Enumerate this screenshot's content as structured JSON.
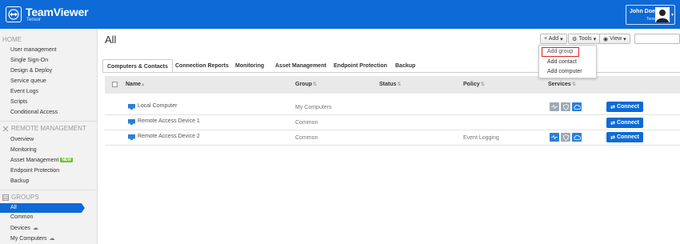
{
  "header": {
    "brand": "TeamViewer",
    "brand_sub": "Tensor",
    "user_name": "John Doe",
    "user_org": "Tensor"
  },
  "sidebar": {
    "home_label": "HOME",
    "home_items": [
      "User management",
      "Single Sign-On",
      "Design & Deploy",
      "Service queue",
      "Event Logs",
      "Scripts",
      "Conditional Access"
    ],
    "remote_label": "REMOTE MANAGEMENT",
    "remote_items": [
      "Overview",
      "Monitoring",
      "Asset Management",
      "Endpoint Protection",
      "Backup"
    ],
    "new_badge": "NEW",
    "groups_label": "GROUPS",
    "group_items": [
      "All",
      "Common",
      "Devices",
      "My Computers"
    ]
  },
  "main": {
    "title": "All",
    "toolbar": {
      "add_label": "+ Add",
      "tools_label": "Tools",
      "view_label": "View",
      "search_value": ""
    },
    "tabs": [
      "Computers & Contacts",
      "Connection Reports",
      "Monitoring",
      "Asset Management",
      "Endpoint Protection",
      "Backup"
    ],
    "columns": [
      "Name",
      "Group",
      "Status",
      "Policy",
      "Services"
    ],
    "rows": [
      {
        "name": "Local Computer",
        "group": "My Computers",
        "status": "",
        "policy": ""
      },
      {
        "name": "Remote Access Device 1",
        "group": "Common",
        "status": "",
        "policy": ""
      },
      {
        "name": "Remote Access Device 2",
        "group": "Common",
        "status": "",
        "policy": "Event Logging"
      }
    ],
    "connect_label": "Connect"
  },
  "add_menu": {
    "items": [
      "Add group",
      "Add contact",
      "Add computer"
    ]
  },
  "colors": {
    "brand_blue": "#0e6ad6",
    "new_badge": "#71c32b",
    "highlight_red": "#e02020"
  }
}
